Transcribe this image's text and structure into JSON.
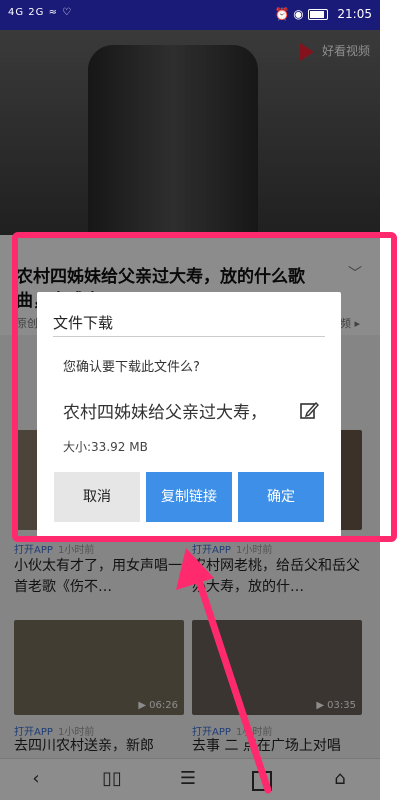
{
  "status_bar": {
    "left_indicators": "4G  2G  ≈  ♡",
    "right_icons": "⏰ ◉",
    "time": "21:05"
  },
  "video": {
    "brand": "好看视频"
  },
  "article": {
    "title": "农村四姊妹给父亲过大寿，放的什么歌曲，太感人了",
    "subline_left": "原创",
    "subline_right": "频 ▸"
  },
  "dialog": {
    "title": "文件下载",
    "message": "您确认要下载此文件么?",
    "filename": "农村四姊妹给父亲过大寿，",
    "size": "大小:33.92 MB",
    "cancel_label": "取消",
    "copy_label": "复制链接",
    "ok_label": "确定"
  },
  "cards": [
    {
      "open": "打开APP",
      "ago": "1小时前",
      "title": "小伙太有才了，用女声唱一首老歌《伤不…"
    },
    {
      "open": "打开APP",
      "ago": "1小时前",
      "title": "农村网老桃，给岳父和岳父办大寿，放的什…"
    },
    {
      "open": "打开APP",
      "ago": "1小时前",
      "duration": "▶ 06:26",
      "title": "去四川农村送亲，新郎"
    },
    {
      "open": "打开APP",
      "ago": "1小时前",
      "duration": "▶ 03:35",
      "title": "去事 二 点在广场上对唱"
    }
  ],
  "bottom_nav": {
    "back": "‹",
    "tabs": "▯▯",
    "menu": "☰",
    "home": "⌂"
  },
  "colors": {
    "highlight": "#ff2a6d",
    "primary_button": "#3d8fe8",
    "status_bar": "#1a1a78"
  }
}
